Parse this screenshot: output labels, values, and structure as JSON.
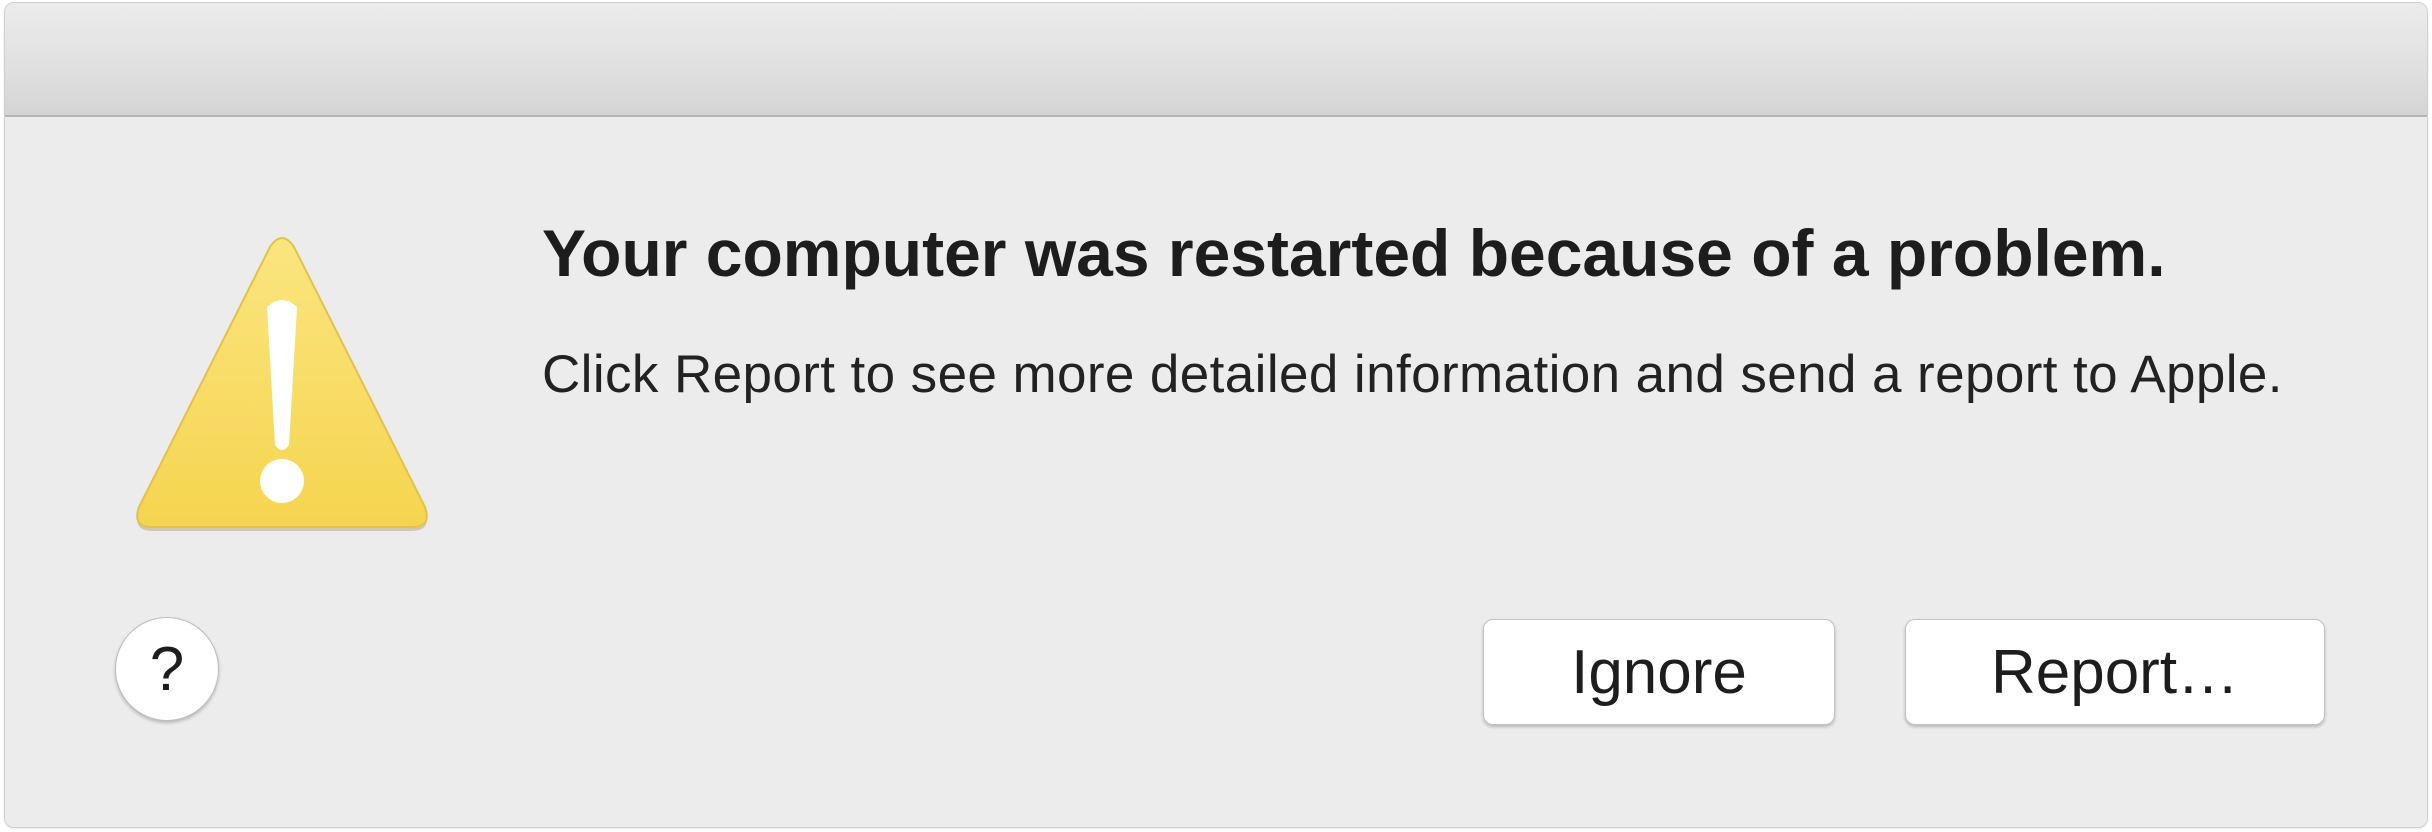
{
  "dialog": {
    "headline": "Your computer was restarted because of a problem.",
    "message": "Click Report to see more detailed information and send a report to Apple.",
    "icon": "warning-triangle-icon",
    "accent_color": "#f8db5e"
  },
  "buttons": {
    "help_label": "?",
    "ignore_label": "Ignore",
    "report_label": "Report…"
  }
}
